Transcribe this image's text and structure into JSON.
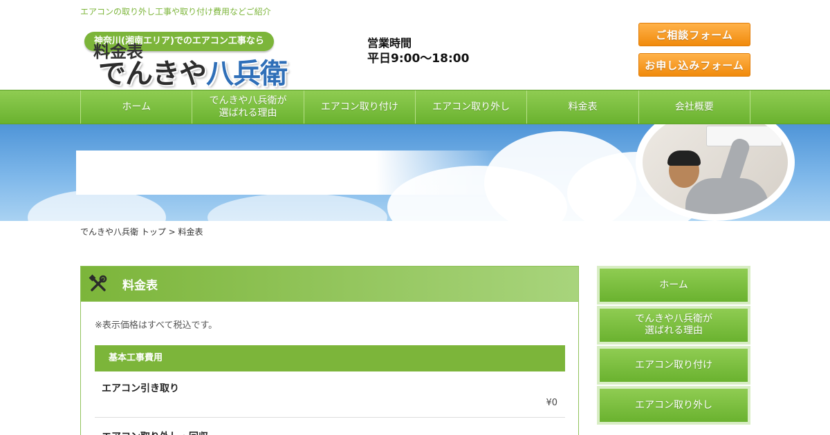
{
  "header": {
    "tagline": "エアコンの取り外し工事や取り付け費用などご紹介",
    "logo_bubble": "神奈川(湘南エリア)でのエアコン工事なら",
    "logo_main_a": "でんきや",
    "logo_main_b": "八兵衛",
    "hours_label": "営業時間",
    "hours_value": "平日9:00～18:00",
    "cta_consult": "ご相談フォーム",
    "cta_apply": "お申し込みフォーム"
  },
  "nav": {
    "items": [
      {
        "label": "ホーム"
      },
      {
        "label": "でんきや八兵衛が\n選ばれる理由"
      },
      {
        "label": "エアコン取り付け"
      },
      {
        "label": "エアコン取り外し"
      },
      {
        "label": "料金表"
      },
      {
        "label": "会社概要"
      }
    ]
  },
  "hero": {
    "title": "料金表"
  },
  "breadcrumb": {
    "text": "でんきや八兵衛 トップ > 料金表"
  },
  "main": {
    "title": "料金表",
    "note": "※表示価格はすべて税込です。",
    "section": "基本工事費用",
    "row1_label": "エアコン引き取り",
    "row1_price": "¥0",
    "row2_label": "エアコン取り外し・回収"
  },
  "sidebar": {
    "items": [
      {
        "label": "ホーム"
      },
      {
        "label": "でんきや八兵衛が\n選ばれる理由"
      },
      {
        "label": "エアコン取り付け"
      },
      {
        "label": "エアコン取り外し"
      }
    ]
  },
  "colors": {
    "brand_green": "#7cb53a",
    "cta_orange": "#f08a0c",
    "logo_blue": "#2f6fb8"
  }
}
